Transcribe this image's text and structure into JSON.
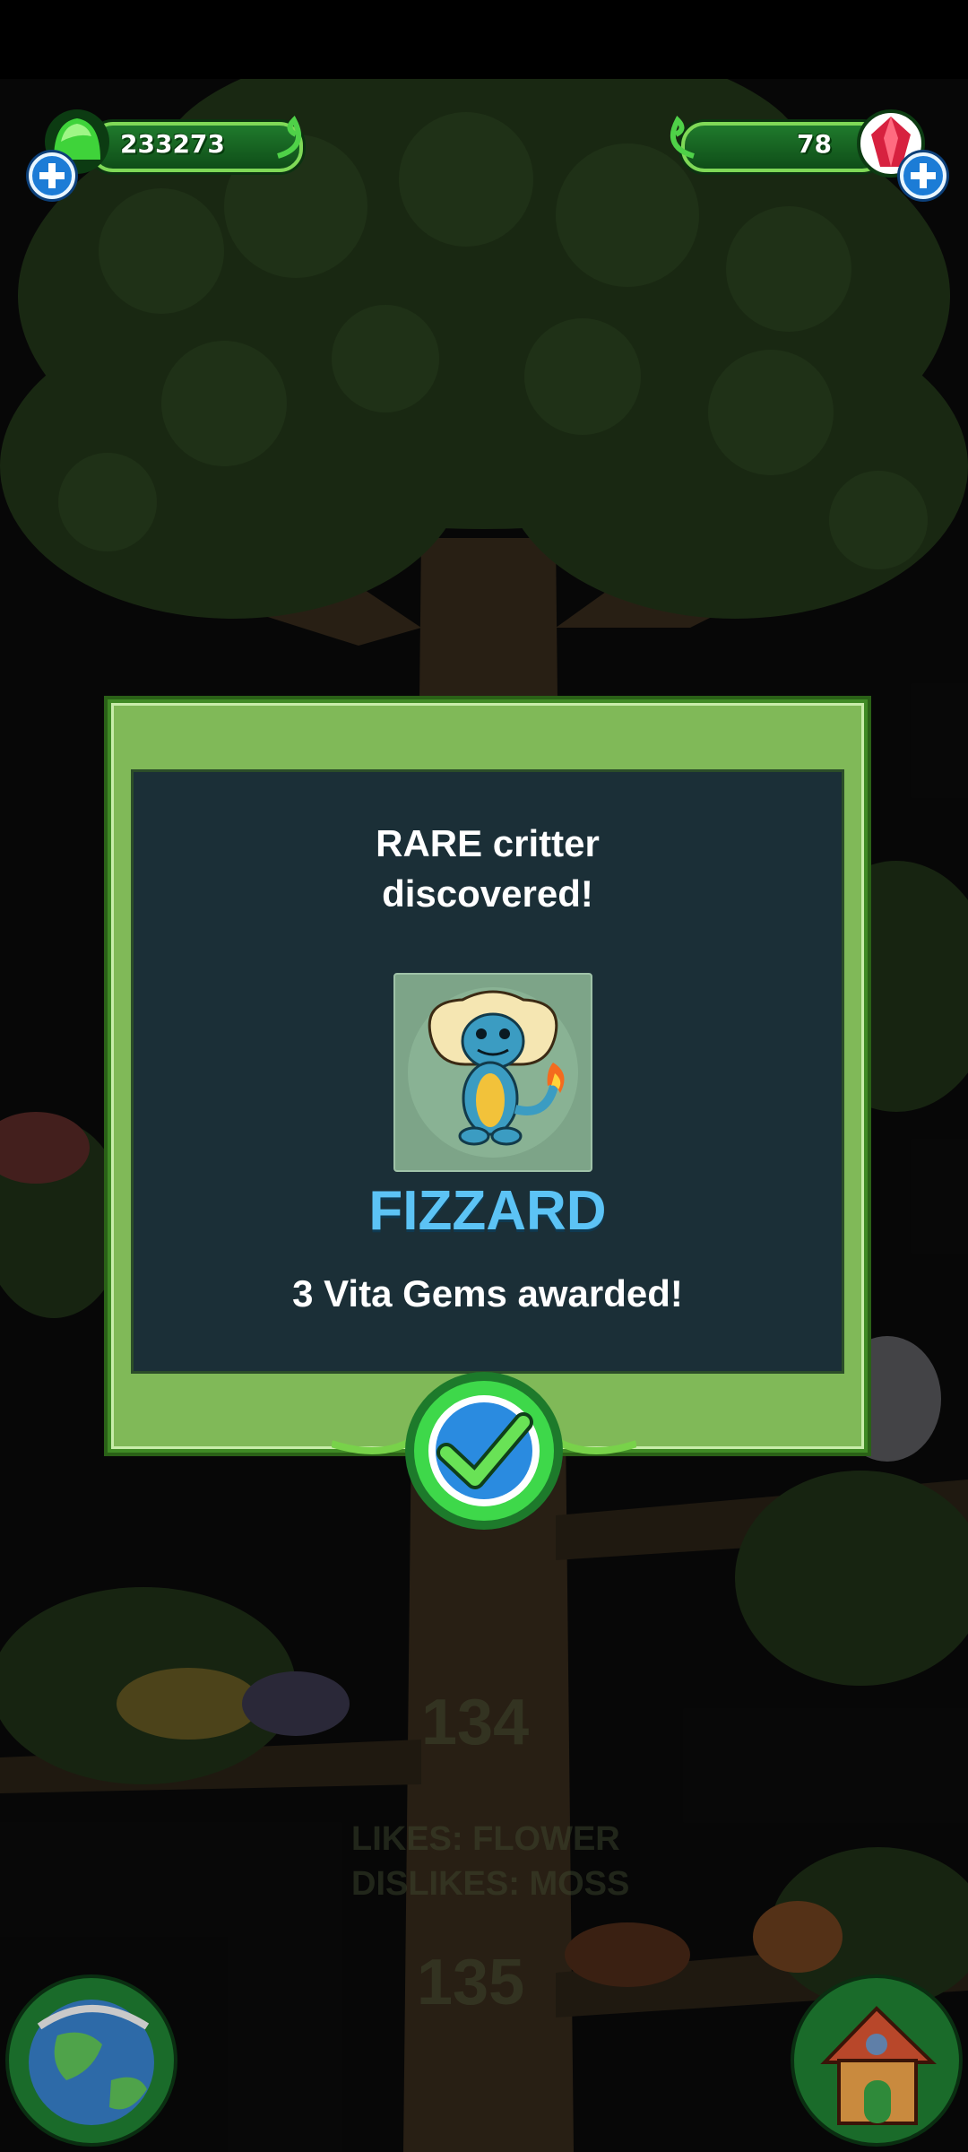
{
  "hud": {
    "left_currency": {
      "value": "233273",
      "icon": "green-gem-icon",
      "add_icon": "plus-icon"
    },
    "right_currency": {
      "value": "78",
      "icon": "red-crystal-icon",
      "add_icon": "plus-icon"
    }
  },
  "dialog": {
    "title": "RARE critter discovered!",
    "critter_name": "FIZZARD",
    "reward": "3 Vita Gems awarded!",
    "confirm_icon": "checkmark-icon"
  },
  "background": {
    "branch_numbers": [
      "134",
      "135"
    ],
    "likes": "LIKES: FLOWER",
    "dislikes": "DISLIKES: MOSS"
  },
  "bottom_bar": {
    "left_icon": "globe-icon",
    "right_icon": "house-icon"
  },
  "colors": {
    "accent_green": "#80b958",
    "panel_dark": "#1b2f37",
    "name_blue": "#5cc3f5"
  }
}
